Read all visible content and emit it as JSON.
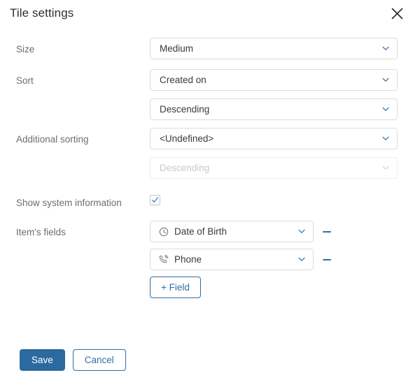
{
  "header": {
    "title": "Tile settings",
    "close_icon": "close-icon"
  },
  "form": {
    "rows": [
      {
        "label": "Size"
      },
      {
        "label": "Sort"
      },
      {
        "label": ""
      },
      {
        "label": "Additional sorting"
      },
      {
        "label": ""
      },
      {
        "label": "Show system information"
      },
      {
        "label": "Item's fields"
      }
    ],
    "size": {
      "label": "Size",
      "value": "Medium",
      "chevron_icon": "chevron-down-icon"
    },
    "sort_field": {
      "label": "Sort",
      "value": "Created on",
      "chevron_icon": "chevron-down-icon"
    },
    "sort_direction": {
      "value": "Descending",
      "chevron_icon": "chevron-down-icon"
    },
    "additional_sort_field": {
      "label": "Additional sorting",
      "value": "<Undefined>",
      "chevron_icon": "chevron-down-icon"
    },
    "additional_sort_direction": {
      "placeholder": "Descending",
      "value": "Descending",
      "disabled": true,
      "chevron_icon": "chevron-down-icon"
    },
    "show_system_information": {
      "label": "Show system information",
      "checked": true,
      "check_icon": "checkmark-icon"
    },
    "item_fields": {
      "label": "Item's fields",
      "items": [
        {
          "value": "Date of Birth",
          "icon": "clock-icon",
          "chevron_icon": "chevron-down-icon",
          "remove_icon": "minus-icon"
        },
        {
          "value": "Phone",
          "icon": "phone-icon",
          "chevron_icon": "chevron-down-icon",
          "remove_icon": "minus-icon"
        }
      ],
      "add_button_label": "+ Field"
    }
  },
  "footer": {
    "save_label": "Save",
    "cancel_label": "Cancel"
  },
  "colors": {
    "accent": "#2f6fa5",
    "primary_button": "#2a6a9e",
    "label_text": "#6d6d6d",
    "value_text": "#3a3a3a",
    "border": "#dcdcdc",
    "disabled_text": "#c9c9c9"
  }
}
